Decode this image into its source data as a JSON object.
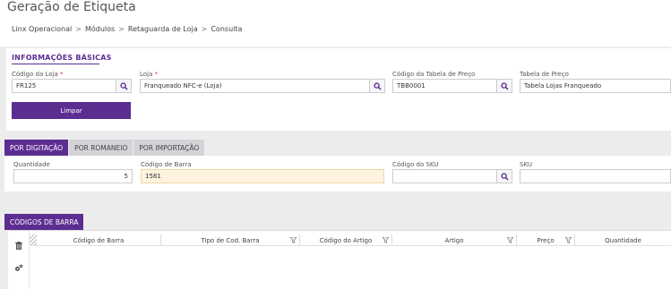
{
  "page": {
    "title": "Geração de Etiqueta",
    "breadcrumb": [
      "Linx Operacional",
      "Módulos",
      "Retaguarda de Loja",
      "Consulta"
    ],
    "breadcrumb_sep": ">"
  },
  "basic_info": {
    "title": "INFORMAÇÕES BÁSICAS",
    "store_code": {
      "label": "Código da Loja",
      "required_mark": "*",
      "value": "FR125"
    },
    "store": {
      "label": "Loja",
      "required_mark": "*",
      "value": "Franqueado NFC-e (Loja)"
    },
    "price_table_code": {
      "label": "Código da Tabela de Preço",
      "value": "TBB0001"
    },
    "price_table": {
      "label": "Tabela de Preço",
      "value": "Tabela Lojas Franqueado"
    },
    "clear_button": "Limpar"
  },
  "tabs": [
    {
      "label": "POR DIGITAÇÃO",
      "active": true
    },
    {
      "label": "POR ROMANEIO",
      "active": false
    },
    {
      "label": "POR IMPORTAÇÃO",
      "active": false
    }
  ],
  "entry": {
    "quantity": {
      "label": "Quantidade",
      "value": "5"
    },
    "barcode": {
      "label": "Código de Barra",
      "value": "1581"
    },
    "sku_code": {
      "label": "Código do SKU",
      "value": ""
    },
    "sku": {
      "label": "SKU",
      "value": ""
    }
  },
  "barcodes_grid": {
    "tab_label": "CÓDIGOS DE BARRA",
    "columns": [
      "Código de Barra",
      "Tipo de Cod. Barra",
      "Código do Artigo",
      "Artigo",
      "Preço",
      "Quantidade"
    ],
    "side_icons": [
      "trash-icon",
      "cogs-icon"
    ],
    "rows": []
  },
  "colors": {
    "accent": "#5c2d91",
    "highlight_field": "#fdf3df"
  }
}
